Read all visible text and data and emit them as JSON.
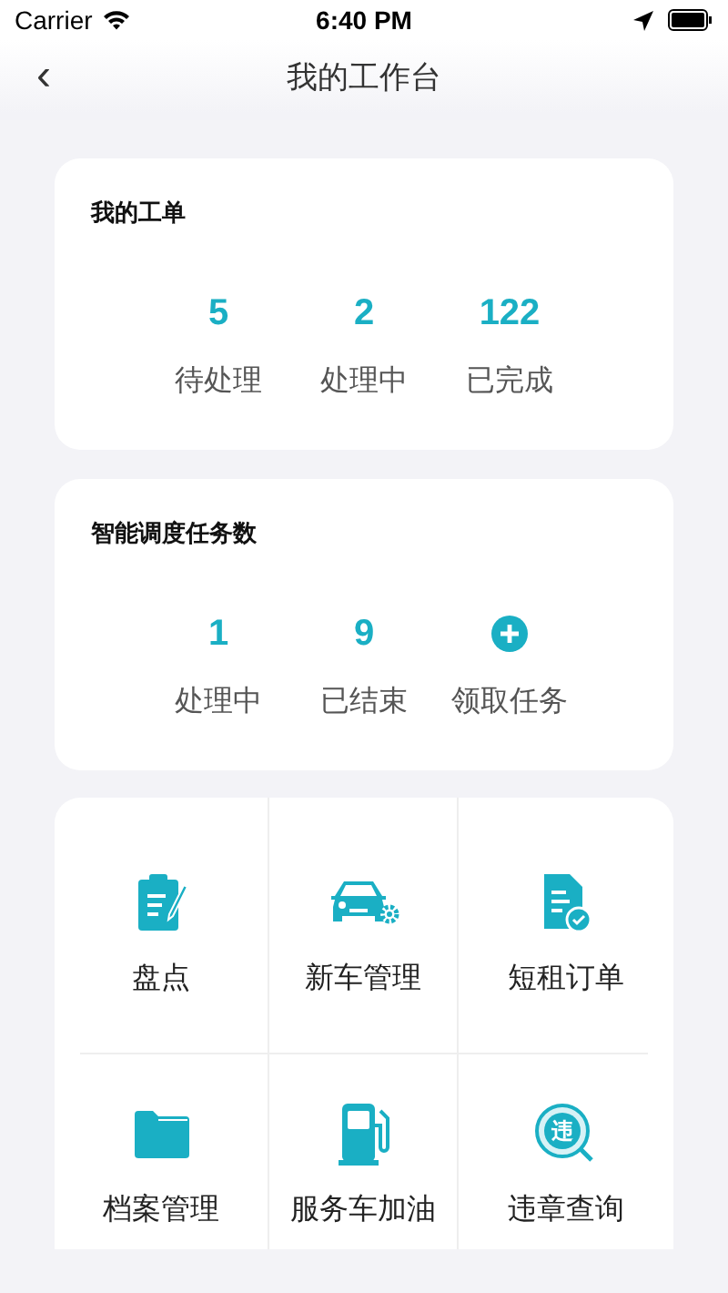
{
  "status_bar": {
    "carrier": "Carrier",
    "time": "6:40 PM"
  },
  "nav": {
    "back": "‹",
    "title": "我的工作台"
  },
  "work_orders": {
    "title": "我的工单",
    "stats": [
      {
        "kind": "number",
        "value": "5",
        "label": "待处理"
      },
      {
        "kind": "number",
        "value": "2",
        "label": "处理中"
      },
      {
        "kind": "number",
        "value": "122",
        "label": "已完成"
      }
    ]
  },
  "dispatch_tasks": {
    "title": "智能调度任务数",
    "stats": [
      {
        "kind": "number",
        "value": "1",
        "label": "处理中"
      },
      {
        "kind": "number",
        "value": "9",
        "label": "已结束"
      },
      {
        "kind": "add",
        "label": "领取任务"
      }
    ]
  },
  "tools": [
    {
      "kind": "clipboard",
      "label": "盘点"
    },
    {
      "kind": "car",
      "label": "新车管理"
    },
    {
      "kind": "document",
      "label": "短租订单"
    },
    {
      "kind": "folder",
      "label": "档案管理"
    },
    {
      "kind": "fuel",
      "label": "服务车加油"
    },
    {
      "kind": "violation",
      "icon_text": "违",
      "label": "违章查询"
    }
  ]
}
